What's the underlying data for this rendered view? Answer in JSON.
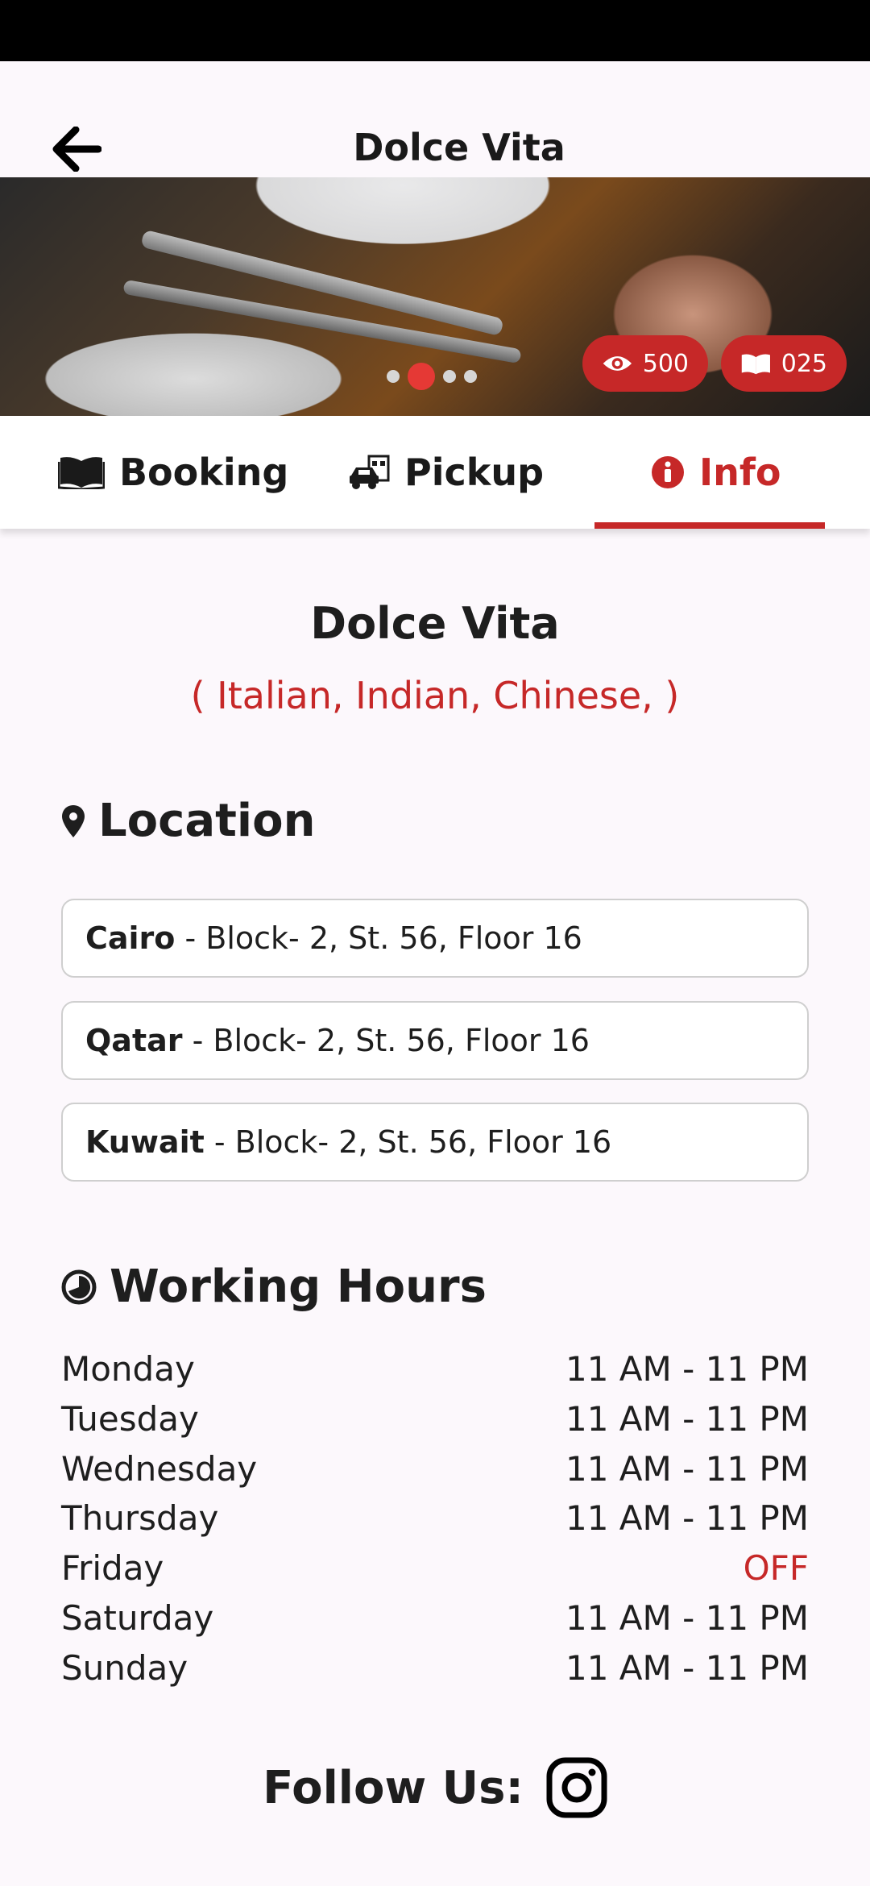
{
  "app_bar": {
    "title": "Dolce Vita"
  },
  "hero": {
    "views": "500",
    "bookings": "025",
    "slides": 4,
    "active_slide": 2
  },
  "tabs": [
    {
      "label": "Booking",
      "icon": "book-icon"
    },
    {
      "label": "Pickup",
      "icon": "car-store-icon"
    },
    {
      "label": "Info",
      "icon": "info-icon",
      "selected": true
    }
  ],
  "restaurant": {
    "name": "Dolce Vita",
    "cuisines": "( Italian, Indian, Chinese, )"
  },
  "location": {
    "title": "Location",
    "items": [
      {
        "city": "Cairo",
        "address": " - Block- 2, St. 56, Floor 16"
      },
      {
        "city": "Qatar",
        "address": " - Block- 2, St. 56, Floor 16"
      },
      {
        "city": "Kuwait",
        "address": " - Block- 2, St. 56, Floor 16"
      }
    ]
  },
  "working_hours": {
    "title": "Working Hours",
    "days": [
      {
        "day": "Monday",
        "hours": "11 AM - 11 PM"
      },
      {
        "day": "Tuesday",
        "hours": "11 AM - 11 PM"
      },
      {
        "day": "Wednesday",
        "hours": "11 AM - 11 PM"
      },
      {
        "day": "Thursday",
        "hours": "11 AM - 11 PM"
      },
      {
        "day": "Friday",
        "hours": "OFF"
      },
      {
        "day": "Saturday",
        "hours": "11 AM - 11 PM"
      },
      {
        "day": "Sunday",
        "hours": "11 AM - 11 PM"
      }
    ]
  },
  "follow": {
    "label": "Follow Us:"
  },
  "colors": {
    "accent": "#c62828",
    "dot_active": "#e53935",
    "background": "#fcf8fc"
  }
}
